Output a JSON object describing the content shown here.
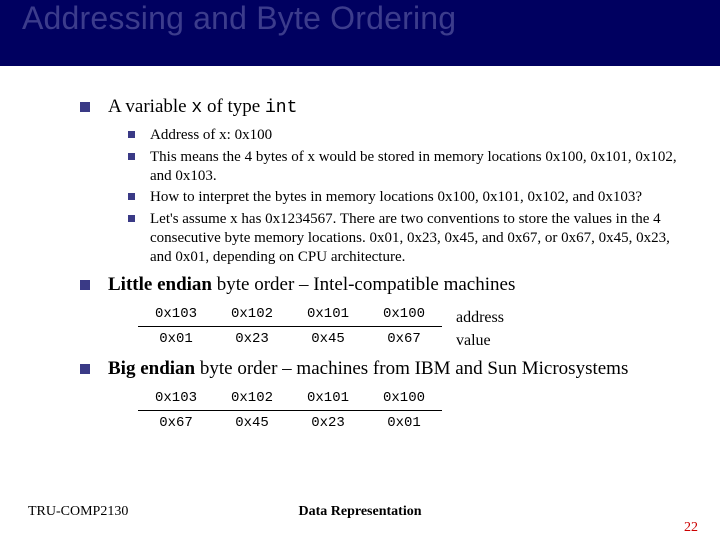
{
  "title": "Addressing and Byte Ordering",
  "bullets": {
    "b1": {
      "pre": "A variable ",
      "code": "x",
      "mid": " of type ",
      "code2": "int"
    },
    "sub": {
      "s1": "Address of x: 0x100",
      "s2": "This means the 4 bytes of x would be stored in memory locations 0x100, 0x101, 0x102, and 0x103.",
      "s3": "How to interpret the bytes in memory locations 0x100, 0x101, 0x102, and 0x103?",
      "s4": "Let's assume x has 0x1234567. There are two conventions to store the values in the 4 consecutive byte memory locations. 0x01, 0x23, 0x45, and 0x67, or 0x67, 0x45, 0x23, and 0x01, depending on CPU architecture."
    },
    "b2": {
      "bold": "Little endian",
      "rest": " byte order – Intel-compatible machines"
    },
    "b3": {
      "bold": "Big endian",
      "rest": " byte order – machines from IBM and Sun Microsystems"
    }
  },
  "little_endian": {
    "addresses": [
      "0x103",
      "0x102",
      "0x101",
      "0x100"
    ],
    "values": [
      "0x01",
      "0x23",
      "0x45",
      "0x67"
    ],
    "addr_label": "address",
    "val_label": "value"
  },
  "big_endian": {
    "addresses": [
      "0x103",
      "0x102",
      "0x101",
      "0x100"
    ],
    "values": [
      "0x67",
      "0x45",
      "0x23",
      "0x01"
    ]
  },
  "footer": {
    "left": "TRU-COMP2130",
    "center": "Data Representation",
    "page": "22"
  }
}
